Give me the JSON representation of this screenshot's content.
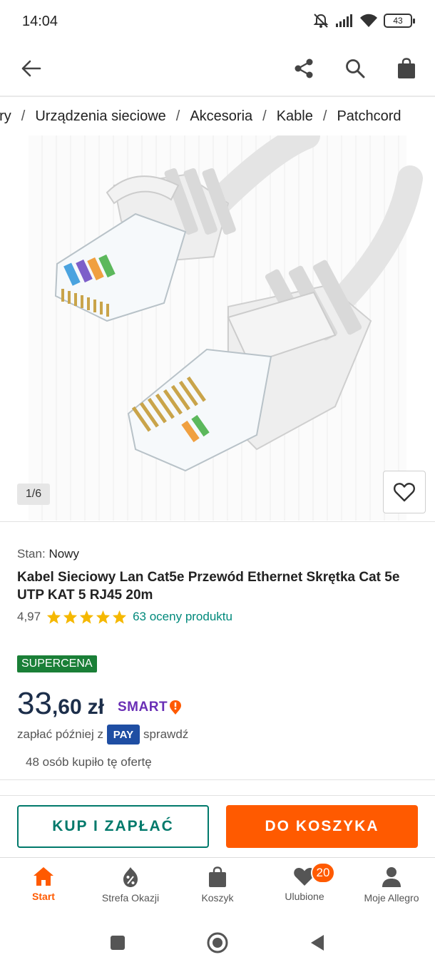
{
  "status_bar": {
    "time": "14:04",
    "battery": "43",
    "icons": [
      "mute-icon",
      "signal-icon",
      "wifi-icon",
      "battery-icon"
    ]
  },
  "app_bar": {
    "icons": [
      "back-arrow-icon",
      "share-icon",
      "search-icon",
      "shopping-bag-icon"
    ]
  },
  "breadcrumb": {
    "items": [
      "ery",
      "Urządzenia sieciowe",
      "Akcesoria",
      "Kable",
      "Patchcord"
    ],
    "separator": "/"
  },
  "gallery": {
    "counter": "1/6",
    "favorite_icon": "heart-outline-icon"
  },
  "product": {
    "condition_label": "Stan:",
    "condition_value": "Nowy",
    "title": "Kabel Sieciowy Lan Cat5e Przewód Ethernet Skrętka Cat 5e UTP KAT 5 RJ45 20m",
    "rating_score": "4,97",
    "rating_stars": 5,
    "rating_count": "63 oceny produktu"
  },
  "offer": {
    "badge": "SUPERCENA",
    "price_int": "33",
    "price_frac": ",60",
    "currency": "zł",
    "smart_label": "SMART",
    "pay_later_prefix": "zapłać później z",
    "pay_badge": "PAY",
    "pay_later_link": "sprawdź",
    "bought_info": "48 osób kupiło tę ofertę"
  },
  "actions": {
    "buy_now": "KUP I ZAPŁAĆ",
    "add_to_cart": "DO KOSZYKA"
  },
  "bottom_nav": {
    "items": [
      {
        "label": "Start",
        "icon": "home-icon",
        "active": true
      },
      {
        "label": "Strefa Okazji",
        "icon": "deals-tag-icon",
        "active": false
      },
      {
        "label": "Koszyk",
        "icon": "cart-bag-icon",
        "active": false
      },
      {
        "label": "Ulubione",
        "icon": "heart-icon",
        "active": false,
        "badge": "20"
      },
      {
        "label": "Moje Allegro",
        "icon": "user-icon",
        "active": false
      }
    ]
  },
  "colors": {
    "accent": "#ff5a00",
    "teal": "#00796b",
    "supercena": "#1a7f37",
    "smart": "#6a2fb5",
    "pay": "#1f4ea3"
  }
}
